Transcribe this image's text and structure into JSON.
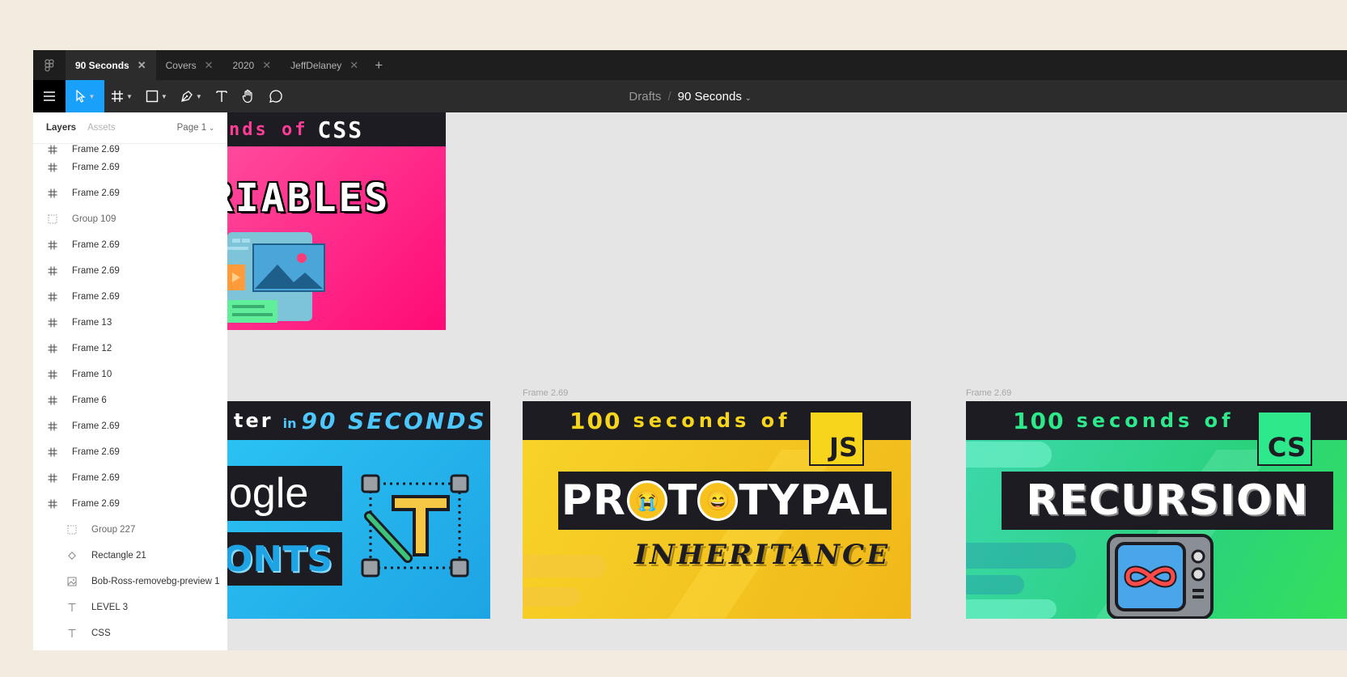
{
  "tabs": [
    {
      "label": "90 Seconds",
      "active": true
    },
    {
      "label": "Covers"
    },
    {
      "label": "2020"
    },
    {
      "label": "JeffDelaney"
    }
  ],
  "breadcrumb": {
    "parent": "Drafts",
    "separator": "/",
    "file": "90 Seconds"
  },
  "panel": {
    "tab_layers": "Layers",
    "tab_assets": "Assets",
    "page": "Page 1"
  },
  "layers": [
    {
      "name": "Frame 2.69",
      "icon": "frame-icon",
      "clipped": true
    },
    {
      "name": "Frame 2.69",
      "icon": "frame-icon"
    },
    {
      "name": "Frame 2.69",
      "icon": "frame-icon"
    },
    {
      "name": "Group 109",
      "icon": "group-icon"
    },
    {
      "name": "Frame 2.69",
      "icon": "frame-icon"
    },
    {
      "name": "Frame 2.69",
      "icon": "frame-icon"
    },
    {
      "name": "Frame 2.69",
      "icon": "frame-icon"
    },
    {
      "name": "Frame 13",
      "icon": "frame-icon"
    },
    {
      "name": "Frame 12",
      "icon": "frame-icon"
    },
    {
      "name": "Frame 10",
      "icon": "frame-icon"
    },
    {
      "name": "Frame 6",
      "icon": "frame-icon"
    },
    {
      "name": "Frame 2.69",
      "icon": "frame-icon"
    },
    {
      "name": "Frame 2.69",
      "icon": "frame-icon"
    },
    {
      "name": "Frame 2.69",
      "icon": "frame-icon"
    },
    {
      "name": "Frame 2.69",
      "icon": "frame-icon"
    },
    {
      "name": "Group 227",
      "icon": "group-icon",
      "child": true
    },
    {
      "name": "Rectangle 21",
      "icon": "component-icon",
      "child": true
    },
    {
      "name": "Bob-Ross-removebg-preview 1",
      "icon": "image-icon",
      "child": true
    },
    {
      "name": "LEVEL 3",
      "icon": "text-icon",
      "child": true
    },
    {
      "name": "CSS",
      "icon": "text-icon",
      "child": true
    }
  ],
  "canvas": {
    "thumb_css": {
      "banner": "nds of",
      "banner_tag": "CSS",
      "title": "RIABLES",
      "colors": {
        "bg": "#ff1f87",
        "banner": "#1c1c22"
      }
    },
    "thumb_fonts": {
      "banner_a": "ter",
      "banner_in": "in",
      "banner_b": "90 SECONDS",
      "word1": "ogle",
      "word2": "ONTS",
      "colors": {
        "bg": "#22b8ec",
        "banner": "#1c1c22",
        "accent": "#4dc8ff"
      }
    },
    "thumb_proto": {
      "label": "Frame 2.69",
      "banner_num": "100",
      "banner_text": "seconds of",
      "tag": "JS",
      "title_a": "PR",
      "title_b": "T",
      "title_c": "TYPAL",
      "subtitle": "INHERITANCE",
      "colors": {
        "bg": "#f4c81f",
        "banner": "#1c1c22",
        "num": "#f7d51d"
      }
    },
    "thumb_rec": {
      "label": "Frame 2.69",
      "banner_num": "100",
      "banner_text": "seconds of",
      "tag": "CS",
      "title": "RECURSION",
      "colors": {
        "bg": "#2ed49a",
        "banner": "#1c1c22",
        "num": "#2ee88c"
      }
    }
  }
}
